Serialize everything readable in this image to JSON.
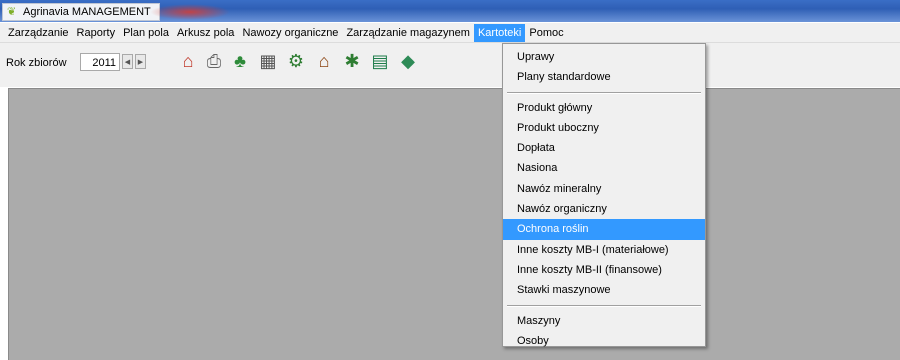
{
  "window": {
    "title": "Agrinavia MANAGEMENT",
    "icon": "leaf-icon"
  },
  "menubar": {
    "items": [
      {
        "label": "Zarządzanie"
      },
      {
        "label": "Raporty"
      },
      {
        "label": "Plan pola"
      },
      {
        "label": "Arkusz pola"
      },
      {
        "label": "Nawozy organiczne"
      },
      {
        "label": "Zarządzanie magazynem"
      },
      {
        "label": "Kartoteki"
      },
      {
        "label": "Pomoc"
      }
    ],
    "active_index": 6
  },
  "toolbar": {
    "year_label": "Rok zbiorów",
    "year_value": "2011",
    "icons": [
      "farm-icon",
      "printer-icon",
      "crop-icon",
      "field-grid-icon",
      "tractor-icon",
      "barn-icon",
      "sprayer-icon",
      "warehouse-icon",
      "machine-icon"
    ]
  },
  "dropdown": {
    "groups": [
      {
        "items": [
          {
            "label": "Uprawy"
          },
          {
            "label": "Plany standardowe"
          }
        ]
      },
      {
        "items": [
          {
            "label": "Produkt główny"
          },
          {
            "label": "Produkt uboczny"
          },
          {
            "label": "Dopłata"
          },
          {
            "label": "Nasiona"
          },
          {
            "label": "Nawóz mineralny"
          },
          {
            "label": "Nawóz organiczny"
          },
          {
            "label": "Ochrona roślin"
          },
          {
            "label": "Inne koszty MB-I (materiałowe)"
          },
          {
            "label": "Inne koszty MB-II (finansowe)"
          },
          {
            "label": "Stawki maszynowe"
          }
        ]
      },
      {
        "items": [
          {
            "label": "Maszyny"
          },
          {
            "label": "Osoby"
          }
        ]
      }
    ],
    "highlighted": "Ochrona roślin"
  },
  "colors": {
    "highlight": "#3399ff",
    "workspace": "#ababab"
  }
}
